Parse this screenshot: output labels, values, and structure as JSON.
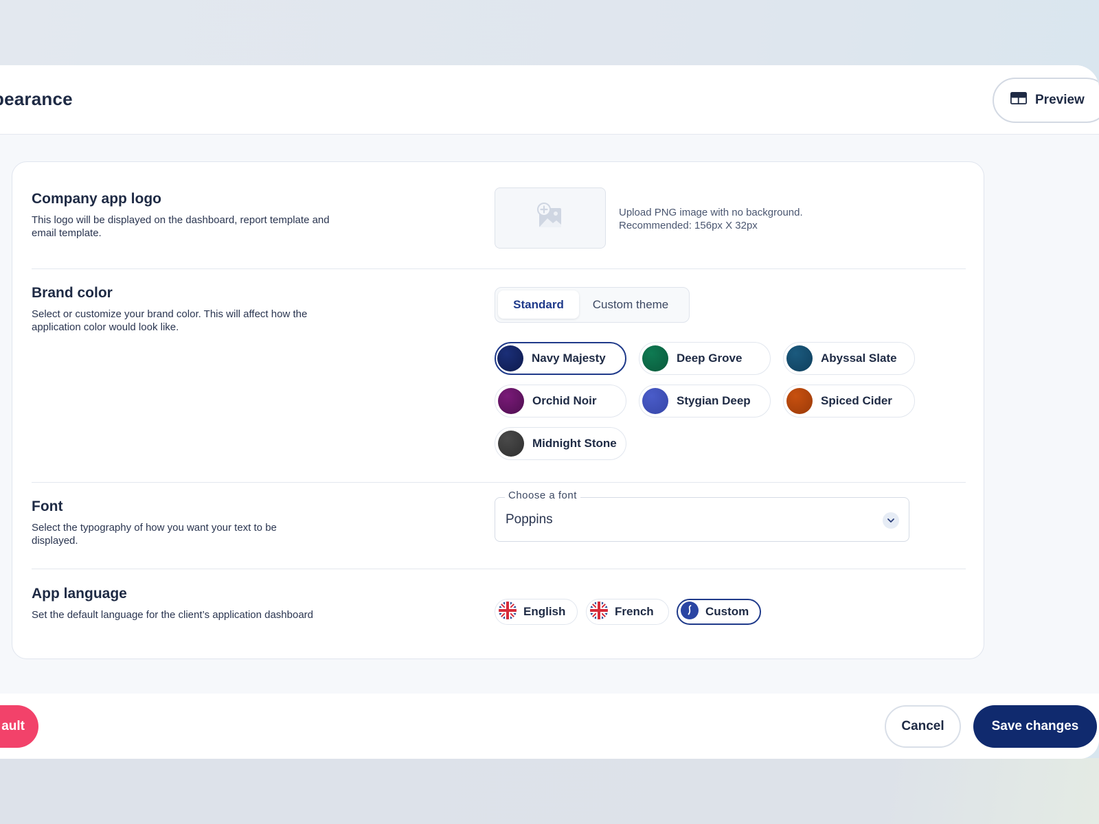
{
  "header": {
    "title": "pearance",
    "preview_label": "Preview"
  },
  "logo_section": {
    "title": "Company app logo",
    "description": "This logo will be displayed on the dashboard, report template and email template.",
    "hint_line1": "Upload PNG image with no background.",
    "hint_line2": "Recommended: 156px X 32px"
  },
  "brand_section": {
    "title": "Brand color",
    "description": "Select or customize your brand color. This will affect how the application color would look like.",
    "tabs": [
      {
        "label": "Standard",
        "active": true
      },
      {
        "label": "Custom theme",
        "active": false
      }
    ],
    "swatches": [
      {
        "label": "Navy Majesty",
        "color": "#1b2f78",
        "color2": "#0d1a4d",
        "selected": true
      },
      {
        "label": "Deep Grove",
        "color": "#0f7a52",
        "color2": "#0a5a3c",
        "selected": false
      },
      {
        "label": "Abyssal Slate",
        "color": "#1b5a7e",
        "color2": "#0f3f5d",
        "selected": false
      },
      {
        "label": "Orchid Noir",
        "color": "#7a1a78",
        "color2": "#4e0f50",
        "selected": false
      },
      {
        "label": "Stygian Deep",
        "color": "#4a5cc9",
        "color2": "#3646a8",
        "selected": false
      },
      {
        "label": "Spiced Cider",
        "color": "#c8500f",
        "color2": "#9a3a08",
        "selected": false
      },
      {
        "label": "Midnight Stone",
        "color": "#4a4a4a",
        "color2": "#2e2e2e",
        "selected": false
      }
    ]
  },
  "font_section": {
    "title": "Font",
    "description": "Select the typography of how you want your text to be displayed.",
    "select_label": "Choose a font",
    "select_value": "Poppins"
  },
  "language_section": {
    "title": "App language",
    "description": "Set the default language for the client’s application dashboard",
    "options": [
      {
        "label": "English",
        "icon": "uk-flag-icon",
        "selected": false
      },
      {
        "label": "French",
        "icon": "uk-flag-icon",
        "selected": false
      },
      {
        "label": "Custom",
        "icon": "custom-language-icon",
        "selected": true
      }
    ]
  },
  "footer": {
    "reset_label": "ault",
    "cancel_label": "Cancel",
    "save_label": "Save changes"
  },
  "colors": {
    "accent": "#1f3a8a",
    "save_button": "#102a6e",
    "danger": "#f2426a"
  }
}
